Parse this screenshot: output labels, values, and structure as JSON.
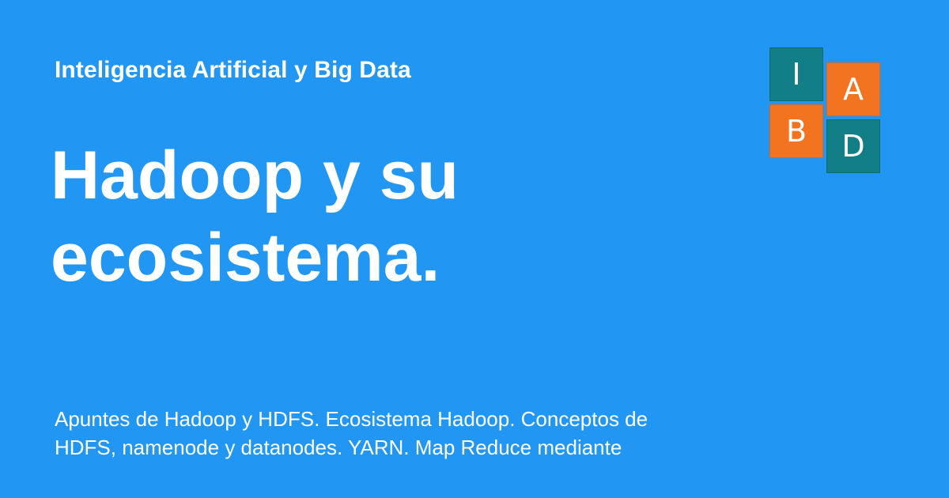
{
  "site": {
    "name": "Inteligencia Artificial y Big Data"
  },
  "page": {
    "title": "Hadoop y su ecosistema.",
    "description": "Apuntes de Hadoop y HDFS. Ecosistema Hadoop. Conceptos de HDFS, namenode y datanodes. YARN. Map Reduce mediante"
  },
  "logo": {
    "tiles": [
      "I",
      "A",
      "B",
      "D"
    ],
    "colors": {
      "teal": "#127e85",
      "orange": "#f37420"
    }
  },
  "colors": {
    "background": "#2196f3",
    "text": "#ffffff"
  }
}
